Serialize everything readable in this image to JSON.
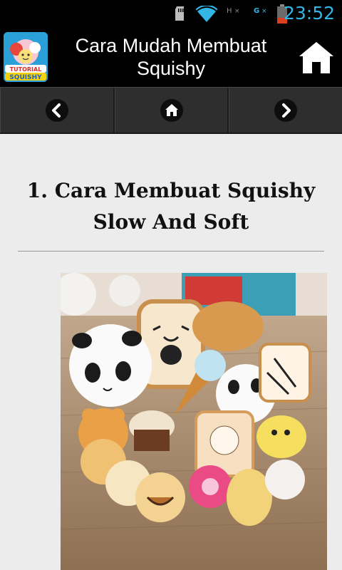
{
  "status_bar": {
    "time": "23:52",
    "icons": [
      "sd-card-icon",
      "wifi-icon",
      "signal-1-icon",
      "signal-2-icon",
      "battery-icon"
    ],
    "network_1": "H",
    "network_2": "G",
    "clock_color": "#33b5e5",
    "battery_color": "#d9411e"
  },
  "app_bar": {
    "logo_text": "TUTORIAL SQUISHY",
    "title": "Cara Mudah Membuat Squishy",
    "home_icon": "home-icon"
  },
  "nav": {
    "items": [
      {
        "icon": "chevron-left-icon"
      },
      {
        "icon": "home-icon"
      },
      {
        "icon": "chevron-right-icon"
      }
    ]
  },
  "article": {
    "title": "1. Cara Membuat Squishy Slow And Soft",
    "image_alt": "squishy-collection-photo"
  },
  "colors": {
    "page_bg": "#ececec",
    "nav_bg": "#2e2e2e",
    "bar_bg": "#000000"
  }
}
